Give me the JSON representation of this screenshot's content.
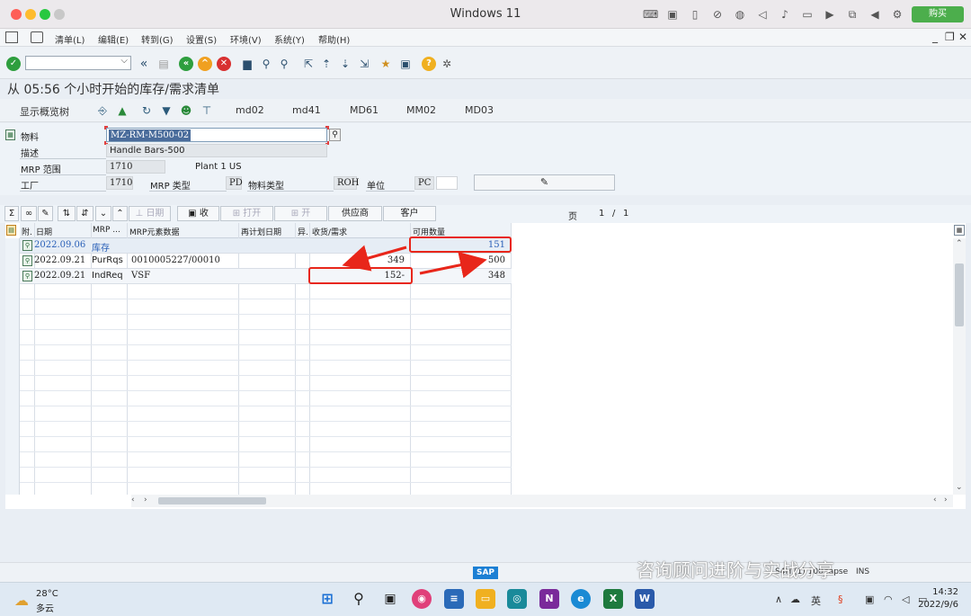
{
  "window": {
    "title": "Windows 11",
    "buy_button": "购买"
  },
  "menu": [
    "清单(L)",
    "编辑(E)",
    "转到(G)",
    "设置(S)",
    "环境(V)",
    "系统(Y)",
    "帮助(H)"
  ],
  "page_title": "从 05:56 个小时开始的库存/需求清单",
  "app_toolbar": {
    "overview_tree": "显示概览树",
    "buttons": [
      "md02",
      "md41",
      "MD61",
      "MM02",
      "MD03"
    ]
  },
  "header": {
    "material_label": "物料",
    "material_value": "MZ-RM-M500-02",
    "description_label": "描述",
    "description_value": "Handle Bars-500",
    "mrp_area_label": "MRP 范围",
    "mrp_area_value": "1710",
    "mrp_area_text": "Plant 1 US",
    "plant_label": "工厂",
    "plant_value": "1710",
    "mrp_type_label": "MRP 类型",
    "mrp_type_value": "PD",
    "material_type_label": "物料类型",
    "material_type_value": "ROH",
    "unit_label": "单位",
    "unit_value": "PC"
  },
  "alv_toolbar": {
    "date_btn": "日期",
    "receive_btn": "收",
    "open_btn": "打开",
    "open2_btn": "开",
    "vendor_btn": "供应商",
    "customer_btn": "客户",
    "page_label": "页",
    "page_current": "1",
    "page_sep": "/",
    "page_total": "1"
  },
  "table": {
    "columns": [
      "附.",
      "日期",
      "MRP ...",
      "MRP元素数据",
      "再计划日期",
      "异.",
      "收货/需求",
      "可用数量"
    ],
    "rows": [
      {
        "date": "2022.09.06",
        "mrp": "库存",
        "data": "",
        "qty": "",
        "avail": "151"
      },
      {
        "date": "2022.09.21",
        "mrp": "PurRqs",
        "data": "0010005227/00010",
        "qty": "349",
        "avail": "500"
      },
      {
        "date": "2022.09.21",
        "mrp": "IndReq",
        "data": "VSF",
        "qty": "152-",
        "avail": "348"
      }
    ]
  },
  "statusbar": {
    "sap_logo": "SAP",
    "system": "S4H (1) 100",
    "client": "sapse",
    "mode": "INS"
  },
  "watermark": "咨询顾问进阶与实战分享",
  "taskbar": {
    "temp": "28°C",
    "weather": "多云",
    "time": "14:32",
    "date": "2022/9/6"
  },
  "colors": {
    "accent_blue": "#2a60b8",
    "annotation_red": "#e8261a",
    "buy_green": "#4cae4c"
  }
}
